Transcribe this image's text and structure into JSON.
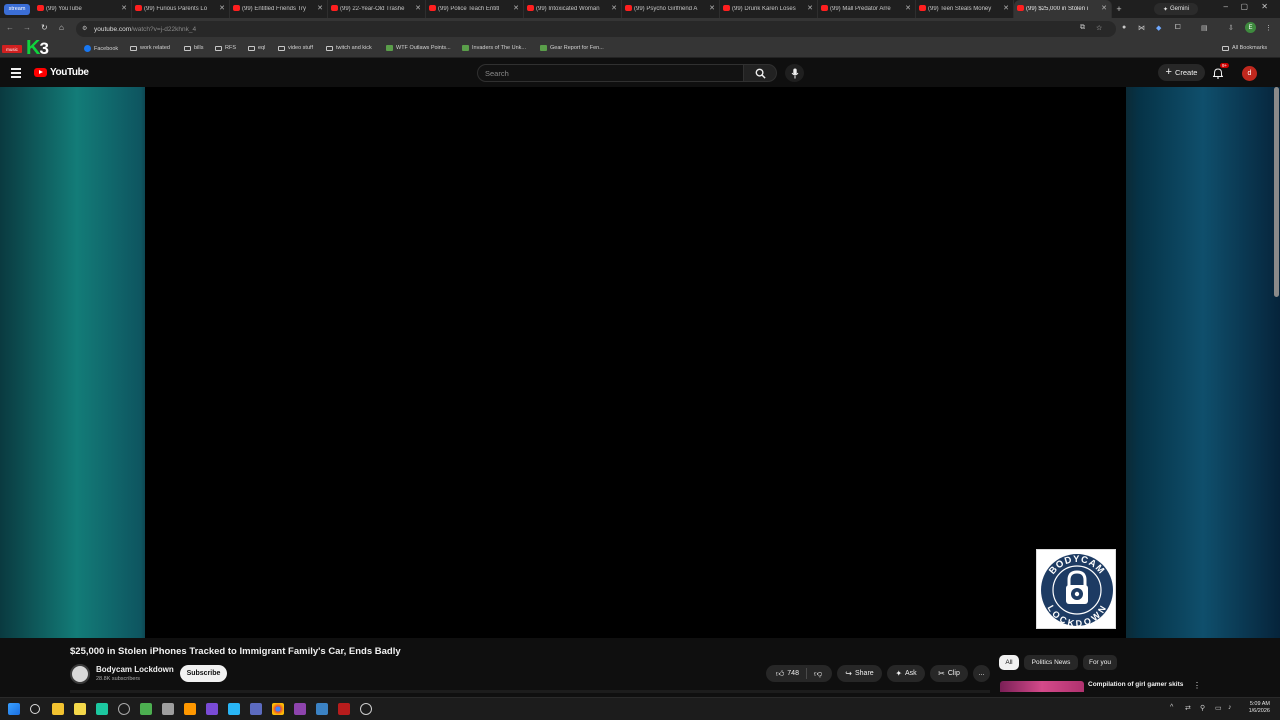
{
  "browser": {
    "stream_chip": "stream",
    "tabs": [
      {
        "title": "(99) YouTube",
        "active": false
      },
      {
        "title": "(99) Furious Parents Lo",
        "active": false
      },
      {
        "title": "(99) Entitled Friends Try",
        "active": false
      },
      {
        "title": "(99) 22-Year-Old Trashe",
        "active": false
      },
      {
        "title": "(99) Police Teach Entitl",
        "active": false
      },
      {
        "title": "(99) Intoxicated Woman",
        "active": false
      },
      {
        "title": "(99) Psycho Girlfriend A",
        "active": false
      },
      {
        "title": "(99) Drunk Karen Loses",
        "active": false
      },
      {
        "title": "(99) Mall Predator Arre",
        "active": false
      },
      {
        "title": "(99) Teen Steals Money",
        "active": false
      },
      {
        "title": "(99) $25,000 in Stolen i",
        "active": true
      }
    ],
    "gemini_label": "Gemini",
    "url_host": "youtube.com",
    "url_path": "/watch?v=j-d22khnk_4",
    "bookmarks": [
      {
        "label": "Facebook",
        "icon": "facebook-icon"
      },
      {
        "label": "work related",
        "icon": "folder-icon"
      },
      {
        "label": "bills",
        "icon": "folder-icon"
      },
      {
        "label": "RFS",
        "icon": "folder-icon"
      },
      {
        "label": "eql",
        "icon": "folder-icon"
      },
      {
        "label": "video stuff",
        "icon": "folder-icon"
      },
      {
        "label": "twitch and kick",
        "icon": "folder-icon"
      },
      {
        "label": "WTF Outlaws Points...",
        "icon": "site-icon"
      },
      {
        "label": "Invaders of The Unk...",
        "icon": "site-icon"
      },
      {
        "label": "Gear Report for Fen...",
        "icon": "site-icon"
      }
    ],
    "all_bookmarks": "All Bookmarks",
    "music_chip": "music",
    "overlay_logo": {
      "k": "K",
      "n": "3"
    }
  },
  "youtube": {
    "logo_text": "YouTube",
    "search_placeholder": "Search",
    "create_label": "Create",
    "notif_badge": "9+",
    "avatar_letter": "d",
    "video": {
      "title": "$25,000 in Stolen iPhones Tracked to Immigrant Family's Car, Ends Badly",
      "channel": "Bodycam Lockdown",
      "subscribers": "28.8K subscribers",
      "subscribe": "Subscribe",
      "likes": "748",
      "share": "Share",
      "ask": "Ask",
      "clip": "Clip",
      "more": "..."
    },
    "watermark": {
      "top": "BODYCAM",
      "bottom": "LOCKDOWN"
    },
    "chips": [
      "All",
      "Politics News",
      "For you"
    ],
    "recommendation": {
      "title": "Compilation of girl gamer skits"
    }
  },
  "taskbar": {
    "time": "5:09 AM",
    "date": "1/6/2026"
  },
  "colors": {
    "yt_red": "#ff0000",
    "bg": "#0f0f0f",
    "k3_green": "#0fd33c"
  }
}
